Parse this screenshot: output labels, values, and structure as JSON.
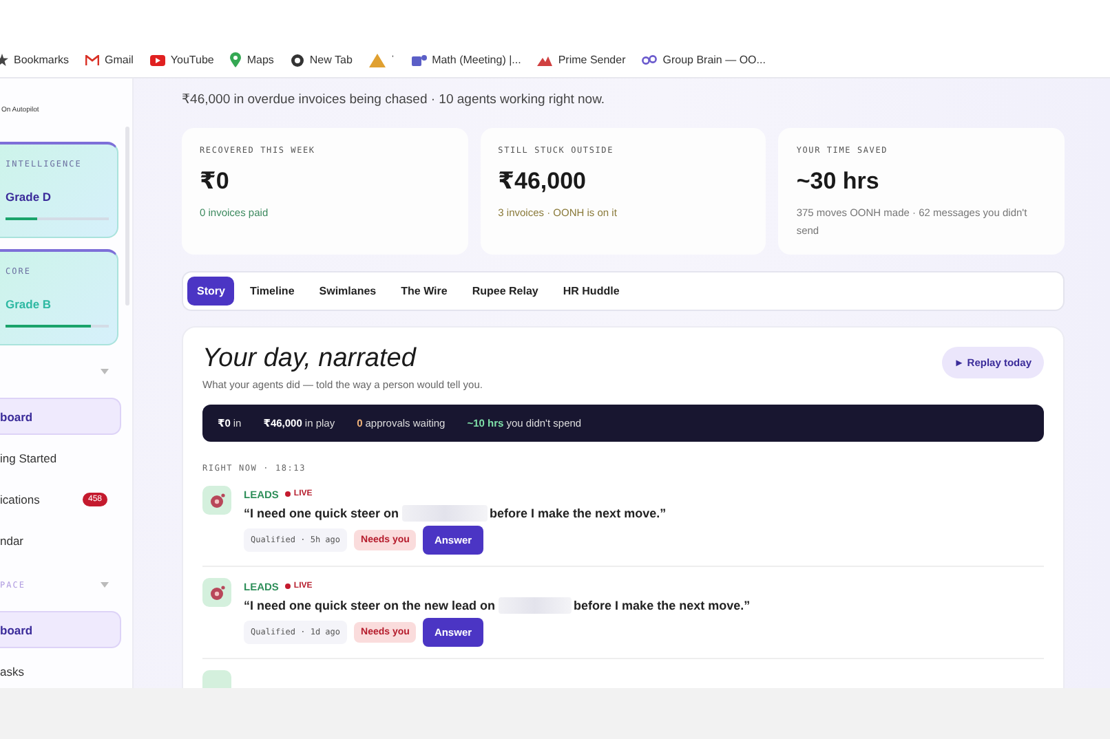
{
  "bookmarks": [
    {
      "label": "Bookmarks"
    },
    {
      "label": "Gmail"
    },
    {
      "label": "YouTube"
    },
    {
      "label": "Maps"
    },
    {
      "label": "New Tab"
    },
    {
      "label": "ˈ"
    },
    {
      "label": "Math (Meeting) |..."
    },
    {
      "label": "Prime Sender"
    },
    {
      "label": "Group Brain — OO..."
    }
  ],
  "sidebar": {
    "brand": "On Autopilot",
    "score_cards": [
      {
        "label": "INTELLIGENCE",
        "grade": "Grade D",
        "level": 0.3
      },
      {
        "label": "CORE",
        "grade": "Grade B",
        "level": 0.83
      }
    ],
    "sections": [
      {
        "items": [
          {
            "label": "board",
            "selected": true
          },
          {
            "label": "ing Started",
            "selected": false
          },
          {
            "label": "ications",
            "selected": false,
            "badge": "458"
          },
          {
            "label": "ndar",
            "selected": false
          }
        ]
      },
      {
        "title": "PACE",
        "items": [
          {
            "label": "board",
            "selected": true
          },
          {
            "label": "asks",
            "selected": false
          }
        ]
      }
    ]
  },
  "banner": "₹46,000 in overdue invoices being chased · 10 agents working right now.",
  "stats": [
    {
      "label": "RECOVERED THIS WEEK",
      "value": "₹0",
      "note": "0 invoices paid",
      "color": "#3d8a5f"
    },
    {
      "label": "STILL STUCK OUTSIDE",
      "value": "₹46,000",
      "note": "3 invoices · OONH is on it",
      "color": "#8a7a3a"
    },
    {
      "label": "YOUR TIME SAVED",
      "value": "~30 hrs",
      "note": "375 moves OONH made · 62 messages you didn't send",
      "color": "#777777"
    }
  ],
  "tabs": [
    {
      "label": "Story",
      "selected": true
    },
    {
      "label": "Timeline",
      "selected": false
    },
    {
      "label": "Swimlanes",
      "selected": false
    },
    {
      "label": "The Wire",
      "selected": false
    },
    {
      "label": "Rupee Relay",
      "selected": false
    },
    {
      "label": "HR Huddle",
      "selected": false
    }
  ],
  "story": {
    "title": "Your day, narrated",
    "subtitle": "What your agents did — told the way a person would tell you.",
    "replay_button": "► Replay today",
    "summary": [
      {
        "value": "₹0",
        "label": "in",
        "color": "#ffffff"
      },
      {
        "value": "₹46,000",
        "label": "in play",
        "color": "#ffffff"
      },
      {
        "value": "0",
        "label": "approvals waiting",
        "color": "#f0b37a"
      },
      {
        "value": "~10 hrs",
        "label": "you didn't spend",
        "color": "#7fe0a8"
      }
    ],
    "section_label": "RIGHT NOW · 18:13",
    "feed": [
      {
        "agent": "LEADS",
        "live": "LIVE",
        "quote_start": "“I need one quick steer on",
        "quote_end": "before I make the next move.”",
        "status": "Qualified · 5h ago",
        "flag": "Needs you",
        "action": "Answer"
      },
      {
        "agent": "LEADS",
        "live": "LIVE",
        "quote_start": "“I need one quick steer on the new lead on",
        "quote_end": "before I make the next move.”",
        "status": "Qualified · 1d ago",
        "flag": "Needs you",
        "action": "Answer"
      }
    ]
  }
}
